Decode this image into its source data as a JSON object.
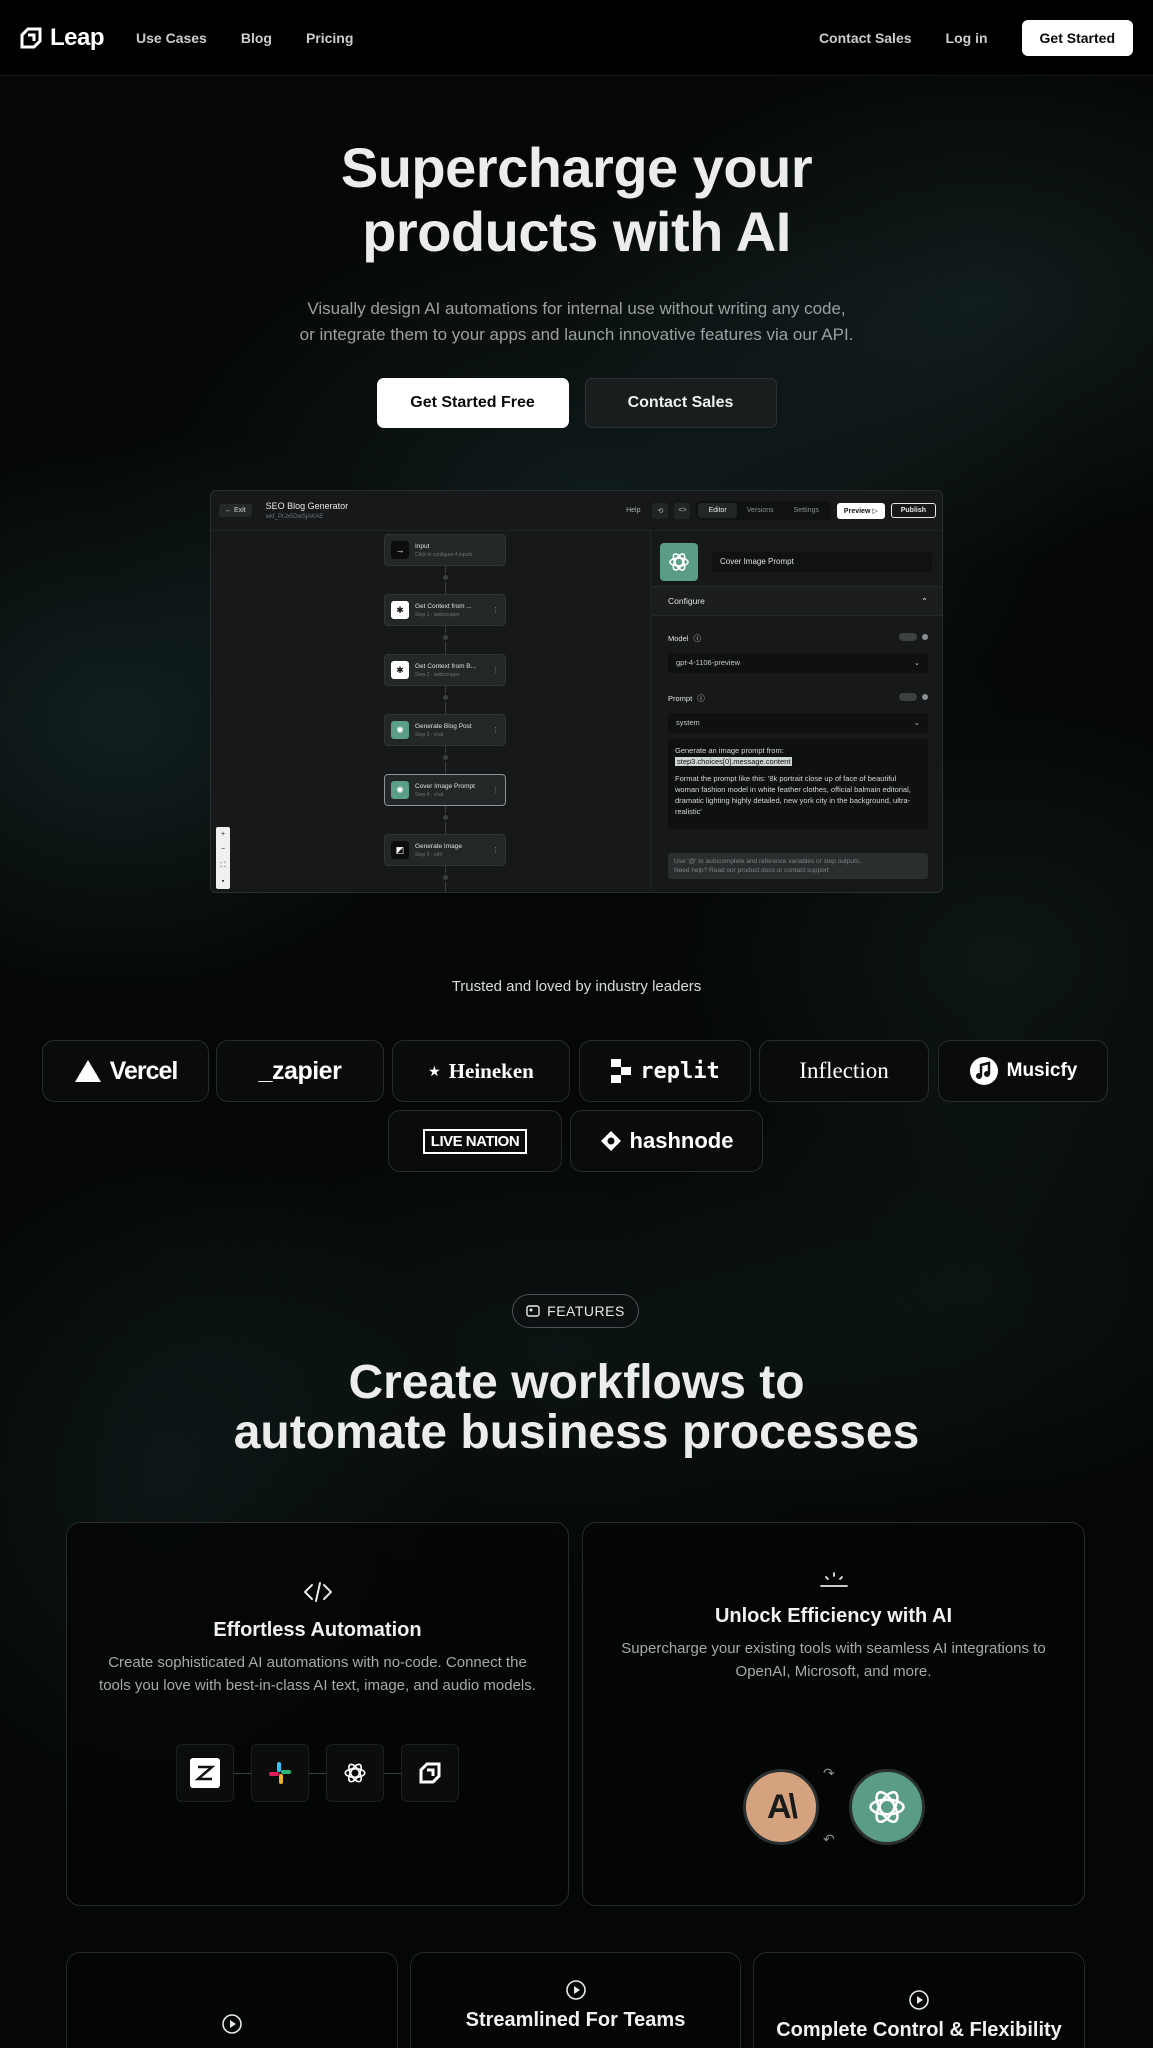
{
  "nav": {
    "logo": "Leap",
    "links": [
      "Use Cases",
      "Blog",
      "Pricing"
    ],
    "contact_sales": "Contact Sales",
    "login": "Log in",
    "get_started": "Get Started"
  },
  "hero": {
    "title_line1": "Supercharge your",
    "title_line2": "products with AI",
    "sub_line1": "Visually design AI automations for internal use without writing any code,",
    "sub_line2": "or integrate them to your apps and launch innovative features via our API.",
    "primary_button": "Get Started Free",
    "secondary_button": "Contact Sales"
  },
  "mockup": {
    "exit": "← Exit",
    "title": "SEO Blog Generator",
    "subtitle": "wkf_PrJx5DwSjAKAE",
    "help": "Help",
    "tabs": [
      "Editor",
      "Versions",
      "Settings"
    ],
    "preview": "Preview ▷",
    "publish": "Publish",
    "nodes": [
      {
        "title": "Input",
        "sub": "Click to configure 4 inputs"
      },
      {
        "title": "Get Context from ...",
        "sub": "Step 1 · webscraper"
      },
      {
        "title": "Get Context from B...",
        "sub": "Step 2 · webscraper"
      },
      {
        "title": "Generate Blog Post",
        "sub": "Step 3 · chat"
      },
      {
        "title": "Cover Image Prompt",
        "sub": "Step 4 · chat"
      },
      {
        "title": "Generate Image",
        "sub": "Step 5 · edit"
      }
    ],
    "panel": {
      "name": "Cover Image Prompt",
      "section": "Configure",
      "model_label": "Model",
      "model_value": "gpt-4-1106-preview",
      "prompt_label": "Prompt",
      "role_value": "system",
      "prompt_line1": "Generate an image prompt from:",
      "prompt_var": "step3.choices[0].message.content",
      "prompt_body": "Format the prompt like this: '8k portrait close up of face of beautiful woman fashion model in white feather clothes, official balmain editorial, dramatic lighting highly detailed, new york city in the background, ultra-realistic'",
      "hint_line1": "Use '@' to autocomplete and reference variables or step outputs.",
      "hint_line2": "Need help? Read our product docs or contact support"
    }
  },
  "trusted": {
    "label": "Trusted and loved by industry leaders",
    "logos": [
      "Vercel",
      "_zapier",
      "Heineken",
      "replit",
      "Inflection",
      "Musicfy",
      "LIVE NATION",
      "hashnode"
    ]
  },
  "features": {
    "pill": "FEATURES",
    "title_line1": "Create workflows to",
    "title_line2": "automate business processes",
    "card1": {
      "title": "Effortless Automation",
      "desc_line1": "Create sophisticated AI automations with no-code. Connect the",
      "desc_line2": "tools you love with best-in-class AI text, image, and audio models."
    },
    "card2": {
      "title": "Unlock Efficiency with AI",
      "desc_line1": "Supercharge your existing tools with seamless AI integrations to",
      "desc_line2": "OpenAI, Microsoft, and more."
    },
    "card4": {
      "title": "Streamlined For Teams"
    },
    "card5": {
      "title": "Complete Control & Flexibility"
    }
  },
  "colors": {
    "background": "#050606",
    "openai_green": "#5a9c84",
    "anthropic_tan": "#d4a27f"
  }
}
